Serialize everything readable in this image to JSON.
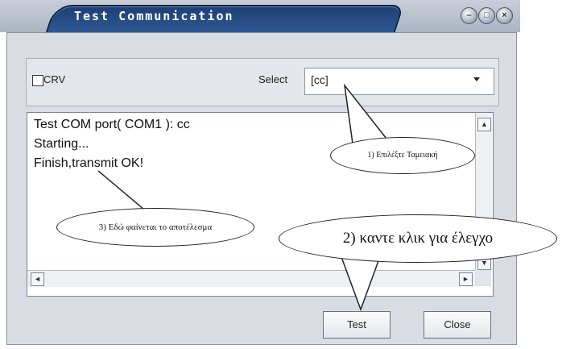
{
  "window": {
    "title": "Test Communication",
    "minimize": "–",
    "maximize": "□",
    "close": "×"
  },
  "options": {
    "crv_label": "CRV",
    "crv_checked": false,
    "select_label": "Select",
    "select_value": "[cc]"
  },
  "log": {
    "lines": [
      "Test COM port( COM1 ): cc",
      "Starting...",
      "Finish,transmit OK!"
    ]
  },
  "buttons": {
    "test": "Test",
    "close": "Close"
  },
  "annotations": {
    "step1": "1) Επιλέξτε Ταμειακή",
    "step2": "2) καντε κλικ για έλεγχο",
    "step3": "3) Εδώ φαίνεται το αποτέλεσμα"
  },
  "colors": {
    "title_tab": "#1d3f73",
    "window_bg": "#d9dde3"
  },
  "icons": {
    "scroll_up": "▲",
    "scroll_down": "▼",
    "scroll_left": "◄",
    "scroll_right": "►"
  }
}
